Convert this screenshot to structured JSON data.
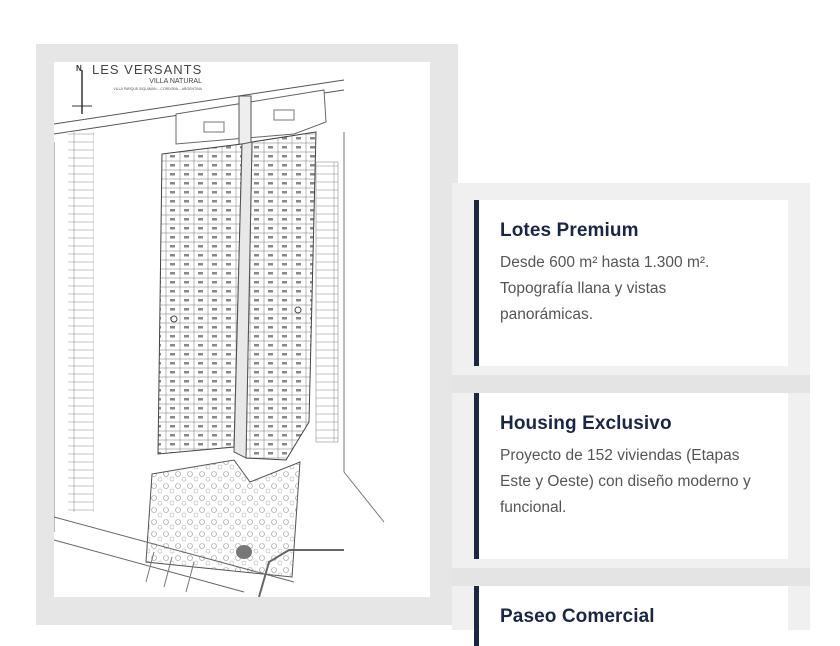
{
  "map": {
    "title": "LES VERSANTS",
    "subtitle": "VILLA NATURAL",
    "location": "VILLA PARQUE SIQUIMAN – CORDOBA – ARGENTINA",
    "north": "N"
  },
  "features": [
    {
      "title": "Lotes Premium",
      "description": "Desde 600 m² hasta 1.300 m². Topografía llana y vistas panorámicas."
    },
    {
      "title": "Housing Exclusivo",
      "description": "Proyecto de 152 viviendas (Etapas Este y Oeste) con diseño moderno y funcional."
    },
    {
      "title": "Paseo Comercial",
      "description": ""
    }
  ],
  "colors": {
    "accent": "#1b2742",
    "panel": "#e6e6e6",
    "features_bg": "#f0f0f0"
  }
}
